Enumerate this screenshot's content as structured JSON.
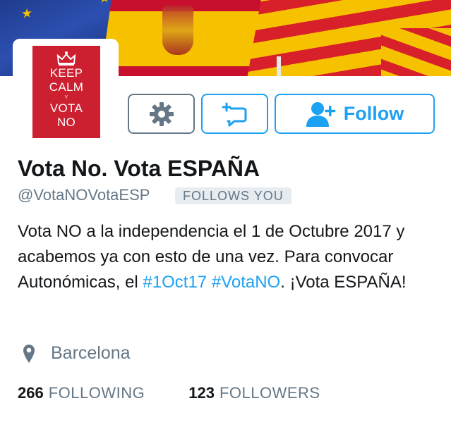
{
  "avatar": {
    "lines": [
      "KEEP",
      "CALM",
      "Y",
      "VOTA",
      "NO"
    ],
    "bg_color": "#cc1f2f"
  },
  "actions": {
    "settings_icon": "gear-icon",
    "message_icon": "direct-message-icon",
    "follow_icon": "add-user-icon",
    "follow_label": "Follow",
    "accent_color": "#1da1f2"
  },
  "profile": {
    "name": "Vota No. Vota ESPAÑA",
    "handle": "@VotaNOVotaESP",
    "follows_you": "FOLLOWS YOU",
    "bio_text_1": "Vota NO a la independencia el 1 de Octubre 2017 y acabemos ya con esto de una vez. Para convocar Autonómicas, el ",
    "bio_tag_1": "#1Oct17",
    "bio_text_2": " ",
    "bio_tag_2": "#VotaNO",
    "bio_text_3": ". ¡Vota ESPAÑA!",
    "location_icon": "location-pin-icon",
    "location": "Barcelona"
  },
  "stats": {
    "following_count": "266",
    "following_label": "FOLLOWING",
    "followers_count": "123",
    "followers_label": "FOLLOWERS"
  }
}
